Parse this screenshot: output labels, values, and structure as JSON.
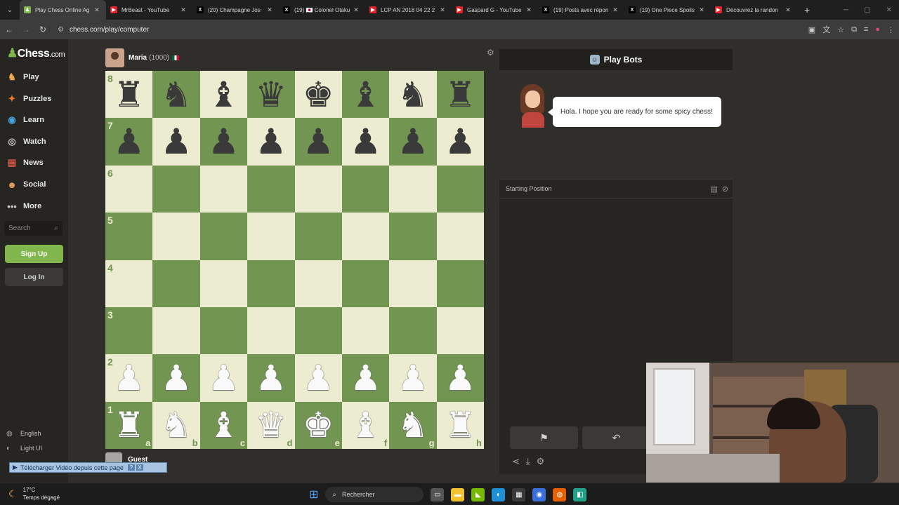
{
  "browser": {
    "tabs": [
      {
        "title": "Play Chess Online Ag",
        "fav_color": "#81b64c",
        "fav_glyph": "♟",
        "active": true
      },
      {
        "title": "MrBeast - YouTube",
        "fav_color": "#e3232b",
        "fav_glyph": "▶"
      },
      {
        "title": "(20) Champagne Jos",
        "fav_color": "#000000",
        "fav_glyph": "X"
      },
      {
        "title": "(19) 🇯🇵 Colonel Otaku",
        "fav_color": "#000000",
        "fav_glyph": "X"
      },
      {
        "title": "LCP AN 2018 04 22 2",
        "fav_color": "#e3232b",
        "fav_glyph": "▶"
      },
      {
        "title": "Gaspard G - YouTube",
        "fav_color": "#e3232b",
        "fav_glyph": "▶"
      },
      {
        "title": "(19) Posts avec répon",
        "fav_color": "#000000",
        "fav_glyph": "X"
      },
      {
        "title": "(19) One Piece Spoils",
        "fav_color": "#000000",
        "fav_glyph": "X"
      },
      {
        "title": "Découvrez la randon",
        "fav_color": "#e3232b",
        "fav_glyph": "▶"
      }
    ],
    "url": "chess.com/play/computer"
  },
  "sidebar": {
    "logo_text": "Chess",
    "logo_suffix": ".com",
    "items": [
      {
        "label": "Play",
        "icon": "♞",
        "color": "#f0a64d"
      },
      {
        "label": "Puzzles",
        "icon": "✦",
        "color": "#f27b2e"
      },
      {
        "label": "Learn",
        "icon": "◉",
        "color": "#4aa3df"
      },
      {
        "label": "Watch",
        "icon": "◎",
        "color": "#c3c2c1"
      },
      {
        "label": "News",
        "icon": "▤",
        "color": "#e05a4a"
      },
      {
        "label": "Social",
        "icon": "☻",
        "color": "#e8a35f"
      },
      {
        "label": "More",
        "icon": "•••",
        "color": "#c3c2c1"
      }
    ],
    "search_placeholder": "Search",
    "signup_label": "Sign Up",
    "login_label": "Log In",
    "language_label": "English",
    "theme_label": "Light UI"
  },
  "game": {
    "opponent_name": "Maria",
    "opponent_rating": "(1000)",
    "player_name": "Guest",
    "board_rows": [
      [
        "♜",
        "♞",
        "♝",
        "♛",
        "♚",
        "♝",
        "♞",
        "♜"
      ],
      [
        "♟",
        "♟",
        "♟",
        "♟",
        "♟",
        "♟",
        "♟",
        "♟"
      ],
      [
        "",
        "",
        "",
        "",
        "",
        "",
        "",
        ""
      ],
      [
        "",
        "",
        "",
        "",
        "",
        "",
        "",
        ""
      ],
      [
        "",
        "",
        "",
        "",
        "",
        "",
        "",
        ""
      ],
      [
        "",
        "",
        "",
        "",
        "",
        "",
        "",
        ""
      ],
      [
        "♟",
        "♟",
        "♟",
        "♟",
        "♟",
        "♟",
        "♟",
        "♟"
      ],
      [
        "♜",
        "♞",
        "♝",
        "♛",
        "♚",
        "♝",
        "♞",
        "♜"
      ]
    ],
    "piece_colors": [
      "b",
      "b",
      "",
      "",
      "",
      "",
      "w",
      "w"
    ],
    "ranks": [
      "8",
      "7",
      "6",
      "5",
      "4",
      "3",
      "2",
      "1"
    ],
    "files": [
      "a",
      "b",
      "c",
      "d",
      "e",
      "f",
      "g",
      "h"
    ]
  },
  "panel": {
    "title": "Play Bots",
    "bot_message": "Hola. I hope you are ready for some spicy chess!",
    "position_label": "Starting Position"
  },
  "overlay": {
    "download_label": "Télécharger Vidéo depuis cette page",
    "download_help": "?",
    "download_close": "X"
  },
  "taskbar": {
    "temperature": "17°C",
    "weather": "Temps dégagé",
    "search_placeholder": "Rechercher",
    "apps": [
      {
        "name": "task-view-icon",
        "color": "#555555",
        "glyph": "▭"
      },
      {
        "name": "file-explorer-icon",
        "color": "#f2c230",
        "glyph": "▬"
      },
      {
        "name": "nvidia-icon",
        "color": "#76b900",
        "glyph": "◣"
      },
      {
        "name": "edge-icon",
        "color": "#1f8fd6",
        "glyph": "◐"
      },
      {
        "name": "store-icon",
        "color": "#3a3a3a",
        "glyph": "▦"
      },
      {
        "name": "chrome-icon",
        "color": "#3a6fd9",
        "glyph": "◉"
      },
      {
        "name": "firefox-icon",
        "color": "#e66000",
        "glyph": "◍"
      },
      {
        "name": "app-icon",
        "color": "#23a08a",
        "glyph": "◧"
      }
    ]
  }
}
